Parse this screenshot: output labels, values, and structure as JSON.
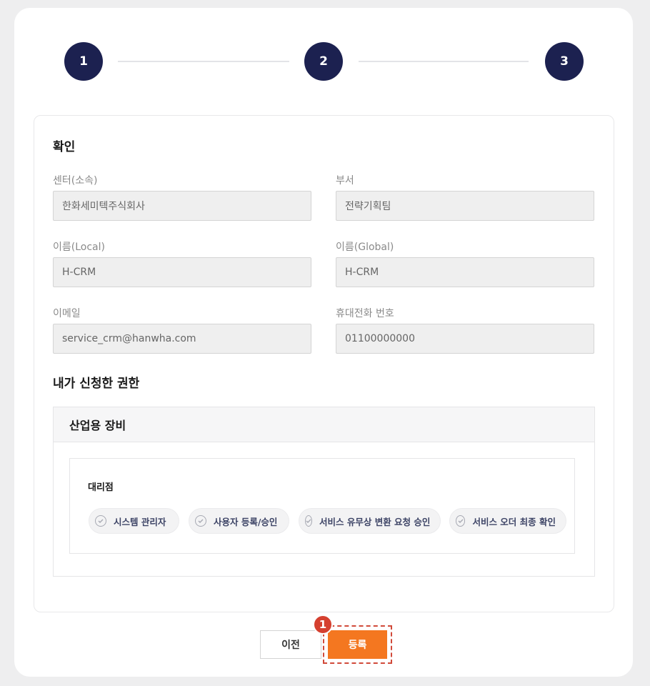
{
  "stepper": {
    "steps": [
      "1",
      "2",
      "3"
    ]
  },
  "confirm": {
    "title": "확인",
    "fields": {
      "center": {
        "label": "센터(소속)",
        "value": "한화세미텍주식회사"
      },
      "dept": {
        "label": "부서",
        "value": "전략기획팀"
      },
      "name_local": {
        "label": "이름(Local)",
        "value": "H-CRM"
      },
      "name_global": {
        "label": "이름(Global)",
        "value": "H-CRM"
      },
      "email": {
        "label": "이메일",
        "value": "service_crm@hanwha.com"
      },
      "phone": {
        "label": "휴대전화 번호",
        "value": "01100000000"
      }
    }
  },
  "permissions": {
    "title": "내가 신청한 권한",
    "group_title": "산업용 장비",
    "subgroup_title": "대리점",
    "chips": [
      "시스템 관리자",
      "사용자 등록/승인",
      "서비스 유무상 변환 요청 승인",
      "서비스 오더 최종 확인"
    ]
  },
  "actions": {
    "prev_label": "이전",
    "submit_label": "등록",
    "marker_number": "1"
  },
  "colors": {
    "accent": "#f47720",
    "step": "#1c2150",
    "marker": "#d5402f"
  }
}
